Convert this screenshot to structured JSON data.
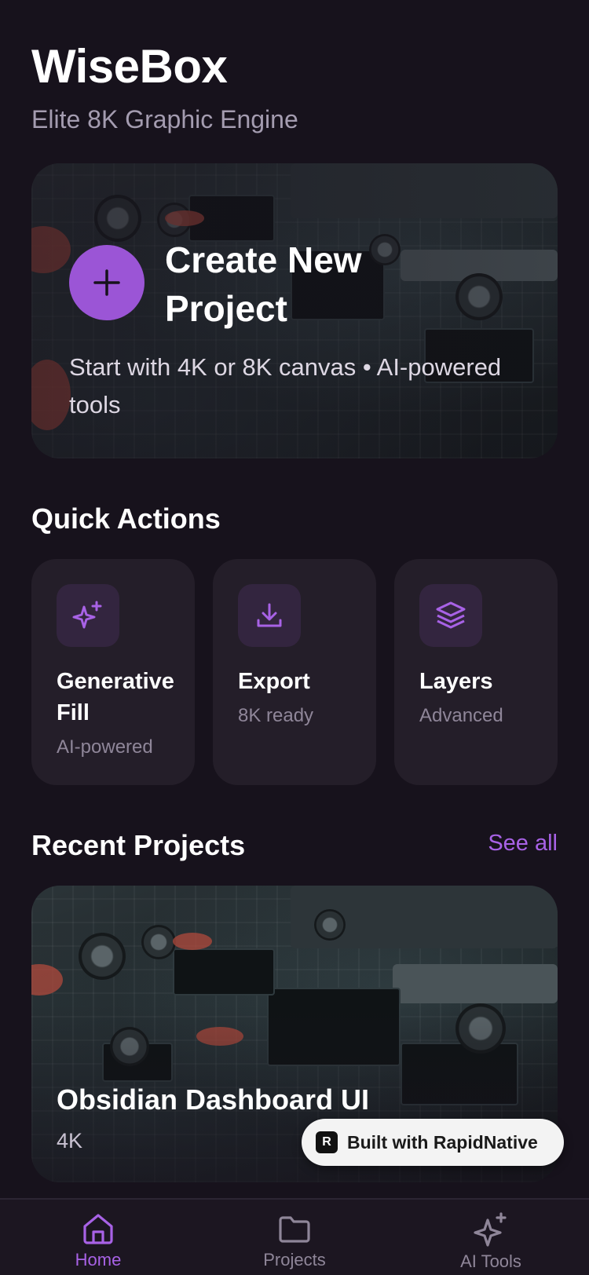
{
  "app": {
    "title": "WiseBox",
    "subtitle": "Elite 8K Graphic Engine"
  },
  "hero": {
    "title": "Create New Project",
    "description": "Start with 4K or 8K canvas • AI-powered tools",
    "icon": "plus-icon"
  },
  "quick_actions": {
    "title": "Quick Actions",
    "items": [
      {
        "title": "Generative Fill",
        "subtitle": "AI-powered",
        "icon": "sparkles-icon"
      },
      {
        "title": "Export",
        "subtitle": "8K ready",
        "icon": "download-icon"
      },
      {
        "title": "Layers",
        "subtitle": "Advanced",
        "icon": "layers-icon"
      }
    ]
  },
  "recent": {
    "title": "Recent Projects",
    "see_all": "See all",
    "projects": [
      {
        "name": "Obsidian Dashboard UI",
        "resolution": "4K"
      }
    ]
  },
  "badge": {
    "text": "Built with RapidNative"
  },
  "nav": {
    "items": [
      {
        "label": "Home",
        "icon": "home-icon",
        "active": true
      },
      {
        "label": "Projects",
        "icon": "folder-icon",
        "active": false
      },
      {
        "label": "AI Tools",
        "icon": "sparkles-icon",
        "active": false
      }
    ]
  },
  "colors": {
    "background": "#17121c",
    "accent": "#9b55d6",
    "card": "#241e29"
  }
}
